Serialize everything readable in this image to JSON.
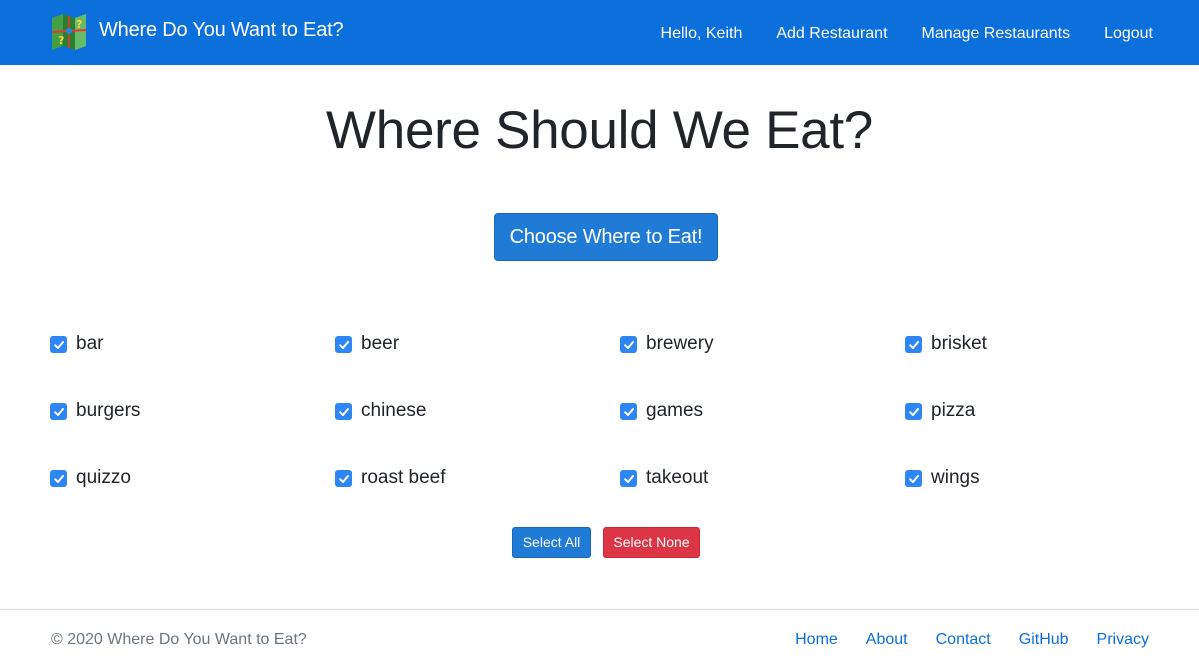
{
  "navbar": {
    "brand": "Where Do You Want to Eat?",
    "logo_icon": "map-question-icon",
    "links": [
      "Hello, Keith",
      "Add Restaurant",
      "Manage Restaurants",
      "Logout"
    ],
    "background": "#0b6fdc"
  },
  "main": {
    "title": "Where Should We Eat?",
    "choose_button": "Choose Where to Eat!",
    "categories": [
      {
        "label": "bar",
        "checked": true
      },
      {
        "label": "beer",
        "checked": true
      },
      {
        "label": "brewery",
        "checked": true
      },
      {
        "label": "brisket",
        "checked": true
      },
      {
        "label": "burgers",
        "checked": true
      },
      {
        "label": "chinese",
        "checked": true
      },
      {
        "label": "games",
        "checked": true
      },
      {
        "label": "pizza",
        "checked": true
      },
      {
        "label": "quizzo",
        "checked": true
      },
      {
        "label": "roast beef",
        "checked": true
      },
      {
        "label": "takeout",
        "checked": true
      },
      {
        "label": "wings",
        "checked": true
      }
    ],
    "select_all": "Select All",
    "select_none": "Select None",
    "colors": {
      "primary": "#1f7bd6",
      "danger": "#dc3545",
      "checkbox": "#2e86f4"
    }
  },
  "footer": {
    "copyright": "© 2020 Where Do You Want to Eat?",
    "links": [
      "Home",
      "About",
      "Contact",
      "GitHub",
      "Privacy"
    ]
  }
}
